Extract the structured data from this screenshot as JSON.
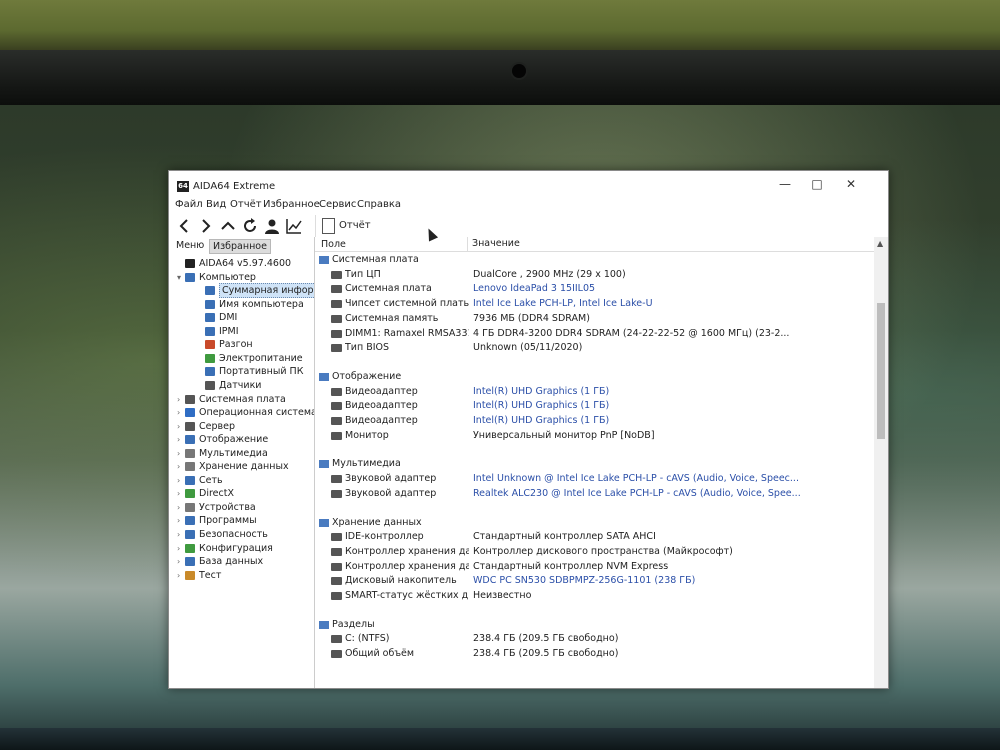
{
  "window": {
    "title": "AIDA64 Extreme",
    "minimize": "—",
    "maximize": "□",
    "close": "✕",
    "app_icon_text": "64"
  },
  "menu": [
    "Файл",
    "Вид",
    "Отчёт",
    "Избранное",
    "Сервис",
    "Справка"
  ],
  "toolbar": {
    "icons": [
      "back-arrow-icon",
      "forward-arrow-icon",
      "up-arrow-icon",
      "refresh-icon",
      "user-icon",
      "chart-icon"
    ],
    "report_label": "Отчёт"
  },
  "sidebar": {
    "tabs": [
      "Меню",
      "Избранное"
    ],
    "tree": [
      {
        "label": "AIDA64 v5.97.4600",
        "level": 0,
        "expander": "",
        "icon": "aida-icon",
        "color": "#222222"
      },
      {
        "label": "Компьютер",
        "level": 0,
        "expander": "v",
        "icon": "computer-icon",
        "color": "#3a6fb5"
      },
      {
        "label": "Суммарная информация",
        "level": 1,
        "expander": "",
        "icon": "summary-icon",
        "color": "#3a6fb5",
        "selected": true
      },
      {
        "label": "Имя компьютера",
        "level": 1,
        "expander": "",
        "icon": "computer-name-icon",
        "color": "#3a6fb5"
      },
      {
        "label": "DMI",
        "level": 1,
        "expander": "",
        "icon": "dmi-icon",
        "color": "#3a6fb5"
      },
      {
        "label": "IPMI",
        "level": 1,
        "expander": "",
        "icon": "ipmi-icon",
        "color": "#3a6fb5"
      },
      {
        "label": "Разгон",
        "level": 1,
        "expander": "",
        "icon": "overclock-icon",
        "color": "#c94a2a"
      },
      {
        "label": "Электропитание",
        "level": 1,
        "expander": "",
        "icon": "power-icon",
        "color": "#3f9a3f"
      },
      {
        "label": "Портативный ПК",
        "level": 1,
        "expander": "",
        "icon": "laptop-icon",
        "color": "#3a6fb5"
      },
      {
        "label": "Датчики",
        "level": 1,
        "expander": "",
        "icon": "sensors-icon",
        "color": "#555555"
      },
      {
        "label": "Системная плата",
        "level": 0,
        "expander": ">",
        "icon": "motherboard-icon",
        "color": "#555555"
      },
      {
        "label": "Операционная система",
        "level": 0,
        "expander": ">",
        "icon": "windows-icon",
        "color": "#2f6dc4"
      },
      {
        "label": "Сервер",
        "level": 0,
        "expander": ">",
        "icon": "server-icon",
        "color": "#555555"
      },
      {
        "label": "Отображение",
        "level": 0,
        "expander": ">",
        "icon": "display-icon",
        "color": "#3a6fb5"
      },
      {
        "label": "Мультимедиа",
        "level": 0,
        "expander": ">",
        "icon": "multimedia-icon",
        "color": "#777777"
      },
      {
        "label": "Хранение данных",
        "level": 0,
        "expander": ">",
        "icon": "storage-icon",
        "color": "#777777"
      },
      {
        "label": "Сеть",
        "level": 0,
        "expander": ">",
        "icon": "network-icon",
        "color": "#3a6fb5"
      },
      {
        "label": "DirectX",
        "level": 0,
        "expander": ">",
        "icon": "directx-icon",
        "color": "#3f9a3f"
      },
      {
        "label": "Устройства",
        "level": 0,
        "expander": ">",
        "icon": "devices-icon",
        "color": "#777777"
      },
      {
        "label": "Программы",
        "level": 0,
        "expander": ">",
        "icon": "programs-icon",
        "color": "#3a6fb5"
      },
      {
        "label": "Безопасность",
        "level": 0,
        "expander": ">",
        "icon": "security-icon",
        "color": "#3a6fb5"
      },
      {
        "label": "Конфигурация",
        "level": 0,
        "expander": ">",
        "icon": "configuration-icon",
        "color": "#3f9a3f"
      },
      {
        "label": "База данных",
        "level": 0,
        "expander": ">",
        "icon": "database-icon",
        "color": "#3a6fb5"
      },
      {
        "label": "Тест",
        "level": 0,
        "expander": ">",
        "icon": "test-icon",
        "color": "#c98a2a"
      }
    ]
  },
  "table": {
    "col_field": "Поле",
    "col_value": "Значение",
    "sections": [
      {
        "title": "Системная плата",
        "icon": "motherboard-icon",
        "items": [
          {
            "field": "Тип ЦП",
            "value": "DualCore , 2900 MHz (29 x 100)",
            "link": false
          },
          {
            "field": "Системная плата",
            "value": "Lenovo IdeaPad 3 15IIL05",
            "link": true
          },
          {
            "field": "Чипсет системной платы",
            "value": "Intel Ice Lake PCH-LP, Intel Ice Lake-U",
            "link": true
          },
          {
            "field": "Системная память",
            "value": "7936 МБ  (DDR4 SDRAM)",
            "link": false
          },
          {
            "field": "DIMM1: Ramaxel RMSA3310...",
            "value": "4 ГБ DDR4-3200 DDR4 SDRAM  (24-22-22-52 @ 1600 МГц)  (23-2...",
            "link": false
          },
          {
            "field": "Тип BIOS",
            "value": "Unknown (05/11/2020)",
            "link": false
          }
        ]
      },
      {
        "title": "Отображение",
        "icon": "display-icon",
        "items": [
          {
            "field": "Видеоадаптер",
            "value": "Intel(R) UHD Graphics  (1 ГБ)",
            "link": true
          },
          {
            "field": "Видеоадаптер",
            "value": "Intel(R) UHD Graphics  (1 ГБ)",
            "link": true
          },
          {
            "field": "Видеоадаптер",
            "value": "Intel(R) UHD Graphics  (1 ГБ)",
            "link": true
          },
          {
            "field": "Монитор",
            "value": "Универсальный монитор PnP [NoDB]",
            "link": false
          }
        ]
      },
      {
        "title": "Мультимедиа",
        "icon": "multimedia-icon",
        "items": [
          {
            "field": "Звуковой адаптер",
            "value": "Intel Unknown @ Intel Ice Lake PCH-LP - cAVS (Audio, Voice, Speec...",
            "link": true
          },
          {
            "field": "Звуковой адаптер",
            "value": "Realtek ALC230 @ Intel Ice Lake PCH-LP - cAVS (Audio, Voice, Spee...",
            "link": true
          }
        ]
      },
      {
        "title": "Хранение данных",
        "icon": "storage-icon",
        "items": [
          {
            "field": "IDE-контроллер",
            "value": "Стандартный контроллер SATA AHCI",
            "link": false
          },
          {
            "field": "Контроллер хранения данн...",
            "value": "Контроллер дискового пространства (Майкрософт)",
            "link": false
          },
          {
            "field": "Контроллер хранения данн...",
            "value": "Стандартный контроллер NVM Express",
            "link": false
          },
          {
            "field": "Дисковый накопитель",
            "value": "WDC PC SN530 SDBPMPZ-256G-1101  (238 ГБ)",
            "link": true
          },
          {
            "field": "SMART-статус жёстких диск...",
            "value": "Неизвестно",
            "link": false
          }
        ]
      },
      {
        "title": "Разделы",
        "icon": "partitions-icon",
        "items": [
          {
            "field": "C: (NTFS)",
            "value": "238.4 ГБ (209.5 ГБ свободно)",
            "link": false
          },
          {
            "field": "Общий объём",
            "value": "238.4 ГБ (209.5 ГБ свободно)",
            "link": false
          }
        ]
      }
    ]
  },
  "colors": {
    "link": "#2b4fa8",
    "section_icon": "#4a7bc0",
    "selection": "#cfe3f7"
  }
}
